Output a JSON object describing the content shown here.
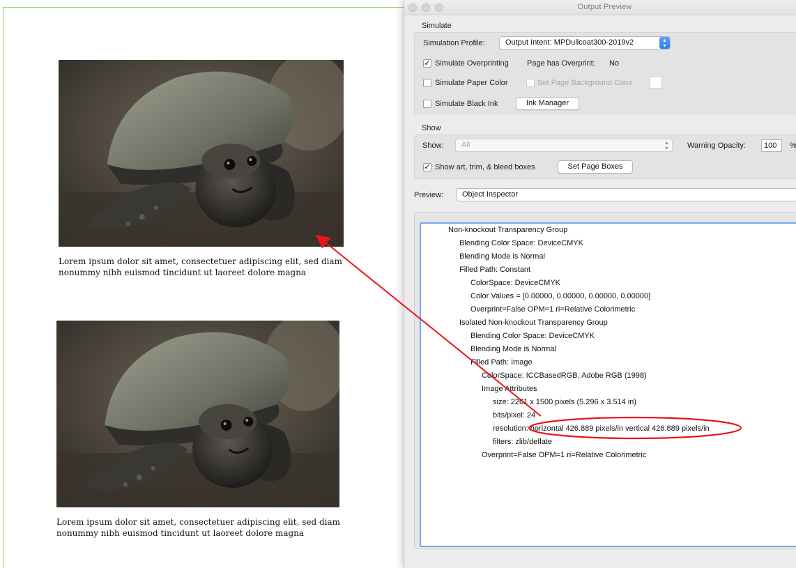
{
  "document": {
    "caption1": "Lorem ipsum dolor sit amet, consectetuer adipiscing elit, sed diam nonummy nibh euismod tincidunt ut laoreet dolore magna",
    "caption2": "Lorem ipsum dolor sit amet, consectetuer adipiscing elit, sed diam nonummy nibh euismod tincidunt ut laoreet dolore magna",
    "caption_line1": "Lorem ipsum dolor sit amet, consectetuer adipiscing elit, sed diam",
    "caption_line2": "nonummy nibh euismod tincidunt ut laoreet dolore magna",
    "image_subject": "turtle-photo"
  },
  "window": {
    "title": "Output Preview"
  },
  "simulate": {
    "group_label": "Simulate",
    "profile_label": "Simulation Profile:",
    "profile_value": "Output Intent: MPDullcoat300-2019v2",
    "overprinting_label": "Simulate Overprinting",
    "overprinting_checked": true,
    "page_overprint_label": "Page has Overprint:",
    "page_overprint_value": "No",
    "paper_color_label": "Simulate Paper Color",
    "paper_color_checked": false,
    "page_bg_label": "Set Page Background Color",
    "page_bg_checked": false,
    "black_ink_label": "Simulate Black Ink",
    "black_ink_checked": false,
    "ink_manager_label": "Ink Manager"
  },
  "show": {
    "group_label": "Show",
    "show_label": "Show:",
    "show_value": "All",
    "warning_opacity_label": "Warning Opacity:",
    "warning_opacity_value": "100",
    "warning_opacity_unit": "%",
    "show_boxes_label": "Show art, trim, & bleed boxes",
    "show_boxes_checked": true,
    "set_page_boxes_label": "Set Page Boxes"
  },
  "preview": {
    "label": "Preview:",
    "value": "Object Inspector"
  },
  "inspector": {
    "lines": [
      "Non-knockout Transparency Group",
      "Blending Color Space: DeviceCMYK",
      "Blending Mode is Normal",
      "Filled Path: Constant",
      "ColorSpace: DeviceCMYK",
      "Color Values = [0.00000, 0.00000, 0.00000, 0.00000]",
      "Overprint=False OPM=1 ri=Relative Colorimetric",
      "Isolated Non-knockout Transparency Group",
      "Blending Color Space: DeviceCMYK",
      "Blending Mode is Normal",
      "Filled Path: Image",
      "ColorSpace: ICCBasedRGB, Adobe RGB (1998)",
      "Image Attributes",
      "size: 2261 x 1500 pixels (5.296 x 3.514 in)",
      "bits/pixel: 24",
      "resolution: horizontal 426.889 pixels/in vertical 426.889 pixels/in",
      "filters: zlib/deflate",
      "Overprint=False OPM=1 ri=Relative Colorimetric"
    ],
    "indent_levels": [
      0,
      1,
      1,
      1,
      2,
      2,
      2,
      1,
      2,
      2,
      2,
      3,
      3,
      4,
      4,
      4,
      4,
      3
    ]
  },
  "annotation": {
    "color": "#e8141b",
    "highlighted_line": 15
  },
  "colors": {
    "window_bg": "#ececec",
    "accent_blue": "#3b86ef",
    "page_border": "#8fd36b"
  }
}
